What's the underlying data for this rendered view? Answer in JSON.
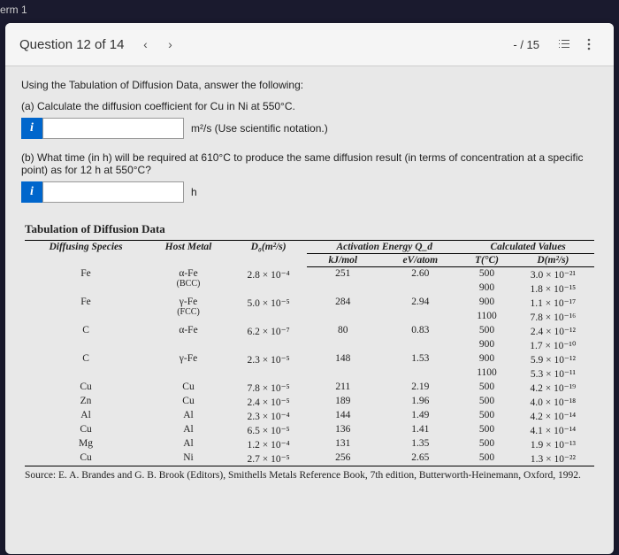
{
  "top_label": "erm 1",
  "header": {
    "question_label": "Question 12 of 14",
    "score": "- / 15"
  },
  "question": {
    "intro": "Using the Tabulation of Diffusion Data, answer the following:",
    "part_a": "(a) Calculate the diffusion coefficient for Cu in Ni at 550°C.",
    "unit_a": "m²/s (Use scientific notation.)",
    "part_b": "(b) What time (in h) will be required at 610°C to produce the same diffusion result (in terms of concentration at a specific point) as for 12 h at 550°C?",
    "unit_b": "h"
  },
  "table": {
    "title": "Tabulation of Diffusion Data",
    "headers": {
      "species": "Diffusing Species",
      "host": "Host Metal",
      "d0": "D₀(m²/s)",
      "activation_group": "Activation Energy Q_d",
      "kjmol": "kJ/mol",
      "evatom": "eV/atom",
      "calc_group": "Calculated Values",
      "tc": "T(°C)",
      "dm2s": "D(m²/s)"
    },
    "rows": [
      {
        "sp": "Fe",
        "host": "α-Fe",
        "sub": "(BCC)",
        "d0": "2.8 × 10⁻⁴",
        "kj": "251",
        "ev": "2.60",
        "t1": "500",
        "d1": "3.0 × 10⁻²¹",
        "t2": "900",
        "d2": "1.8 × 10⁻¹⁵"
      },
      {
        "sp": "Fe",
        "host": "γ-Fe",
        "sub": "(FCC)",
        "d0": "5.0 × 10⁻⁵",
        "kj": "284",
        "ev": "2.94",
        "t1": "900",
        "d1": "1.1 × 10⁻¹⁷",
        "t2": "1100",
        "d2": "7.8 × 10⁻¹⁶"
      },
      {
        "sp": "C",
        "host": "α-Fe",
        "sub": "",
        "d0": "6.2 × 10⁻⁷",
        "kj": "80",
        "ev": "0.83",
        "t1": "500",
        "d1": "2.4 × 10⁻¹²",
        "t2": "900",
        "d2": "1.7 × 10⁻¹⁰"
      },
      {
        "sp": "C",
        "host": "γ-Fe",
        "sub": "",
        "d0": "2.3 × 10⁻⁵",
        "kj": "148",
        "ev": "1.53",
        "t1": "900",
        "d1": "5.9 × 10⁻¹²",
        "t2": "1100",
        "d2": "5.3 × 10⁻¹¹"
      },
      {
        "sp": "Cu",
        "host": "Cu",
        "sub": "",
        "d0": "7.8 × 10⁻⁵",
        "kj": "211",
        "ev": "2.19",
        "t1": "500",
        "d1": "4.2 × 10⁻¹⁹",
        "t2": "",
        "d2": ""
      },
      {
        "sp": "Zn",
        "host": "Cu",
        "sub": "",
        "d0": "2.4 × 10⁻⁵",
        "kj": "189",
        "ev": "1.96",
        "t1": "500",
        "d1": "4.0 × 10⁻¹⁸",
        "t2": "",
        "d2": ""
      },
      {
        "sp": "Al",
        "host": "Al",
        "sub": "",
        "d0": "2.3 × 10⁻⁴",
        "kj": "144",
        "ev": "1.49",
        "t1": "500",
        "d1": "4.2 × 10⁻¹⁴",
        "t2": "",
        "d2": ""
      },
      {
        "sp": "Cu",
        "host": "Al",
        "sub": "",
        "d0": "6.5 × 10⁻⁵",
        "kj": "136",
        "ev": "1.41",
        "t1": "500",
        "d1": "4.1 × 10⁻¹⁴",
        "t2": "",
        "d2": ""
      },
      {
        "sp": "Mg",
        "host": "Al",
        "sub": "",
        "d0": "1.2 × 10⁻⁴",
        "kj": "131",
        "ev": "1.35",
        "t1": "500",
        "d1": "1.9 × 10⁻¹³",
        "t2": "",
        "d2": ""
      },
      {
        "sp": "Cu",
        "host": "Ni",
        "sub": "",
        "d0": "2.7 × 10⁻⁵",
        "kj": "256",
        "ev": "2.65",
        "t1": "500",
        "d1": "1.3 × 10⁻²²",
        "t2": "",
        "d2": ""
      }
    ],
    "source": "Source: E. A. Brandes and G. B. Brook (Editors), Smithells Metals Reference Book, 7th edition, Butterworth-Heinemann, Oxford, 1992."
  }
}
